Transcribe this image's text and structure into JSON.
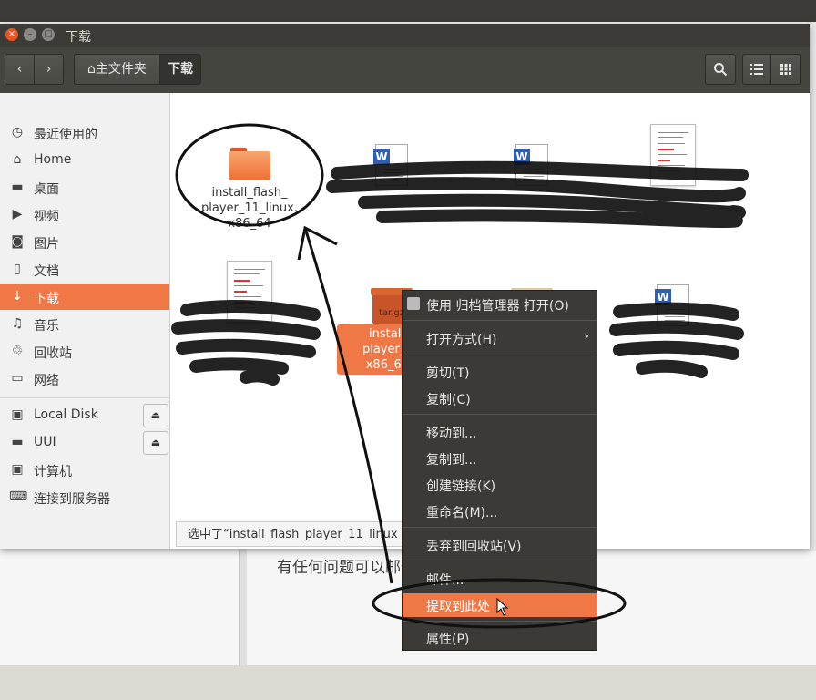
{
  "background": {
    "contact_text": "有任何问题可以邮件到:kf@ok点com"
  },
  "window": {
    "title": "下载",
    "buttons": {
      "close": "×",
      "minimize": "–",
      "maximize": "□"
    }
  },
  "toolbar": {
    "back_icon": "‹",
    "forward_icon": "›",
    "breadcrumb_home": "⌂主文件夹",
    "breadcrumb_current": "下载",
    "search_icon": "search-icon",
    "list_view_icon": "list-icon",
    "grid_view_icon": "grid-icon"
  },
  "sidebar": {
    "items": [
      {
        "label": "最近使用的",
        "icon": "◷"
      },
      {
        "label": "Home",
        "icon": "⌂"
      },
      {
        "label": "桌面",
        "icon": "▬"
      },
      {
        "label": "视频",
        "icon": "▶"
      },
      {
        "label": "图片",
        "icon": "◙"
      },
      {
        "label": "文档",
        "icon": "▯"
      },
      {
        "label": "下载",
        "icon": "↓"
      },
      {
        "label": "音乐",
        "icon": "♫"
      },
      {
        "label": "回收站",
        "icon": "♲"
      },
      {
        "label": "网络",
        "icon": "▭"
      }
    ],
    "devices": [
      {
        "label": "Local Disk",
        "icon": "▣",
        "eject": "⏏"
      },
      {
        "label": "UUI",
        "icon": "▬",
        "eject": "⏏"
      },
      {
        "label": "计算机",
        "icon": "▣"
      },
      {
        "label": "连接到服务器",
        "icon": "⌨"
      }
    ]
  },
  "files": [
    {
      "name": "install_flash_\nplayer_11_linux.\nx86_64",
      "type": "folder"
    },
    {
      "name": "install_f\nplayer_11\nx86_64.t",
      "type": "archive",
      "label": "tar.gz"
    }
  ],
  "statusbar": {
    "text": "选中了“install_flash_player_11_linux"
  },
  "context_menu": {
    "items": [
      {
        "label": "使用 归档管理器 打开(O)"
      },
      {
        "label": "打开方式(H)"
      },
      {
        "label": "剪切(T)"
      },
      {
        "label": "复制(C)"
      },
      {
        "label": "移动到..."
      },
      {
        "label": "复制到..."
      },
      {
        "label": "创建链接(K)"
      },
      {
        "label": "重命名(M)..."
      },
      {
        "label": "丢弃到回收站(V)"
      },
      {
        "label": "邮件..."
      },
      {
        "label": "提取到此处"
      },
      {
        "label": "属性(P)"
      }
    ],
    "submenu_arrow": "›",
    "highlight_color": "#f07746"
  },
  "colors": {
    "accent": "#f07746",
    "titlebar": "#3c3b37",
    "toolbar": "#454540",
    "menu_bg": "#3b3a36"
  }
}
